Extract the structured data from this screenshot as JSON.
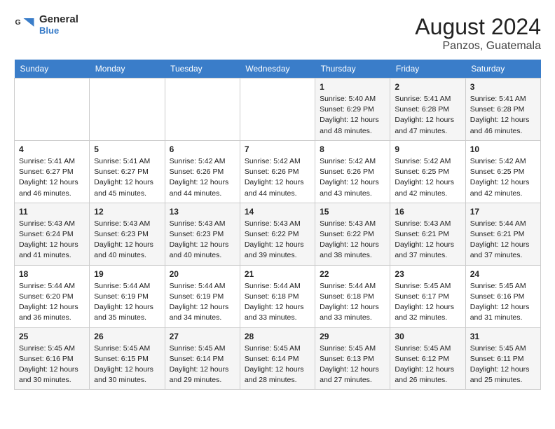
{
  "logo": {
    "name1": "General",
    "name2": "Blue",
    "icon_color": "#3a7dc9"
  },
  "title": "August 2024",
  "subtitle": "Panzos, Guatemala",
  "days_of_week": [
    "Sunday",
    "Monday",
    "Tuesday",
    "Wednesday",
    "Thursday",
    "Friday",
    "Saturday"
  ],
  "weeks": [
    [
      {
        "day": "",
        "info": ""
      },
      {
        "day": "",
        "info": ""
      },
      {
        "day": "",
        "info": ""
      },
      {
        "day": "",
        "info": ""
      },
      {
        "day": "1",
        "info": "Sunrise: 5:40 AM\nSunset: 6:29 PM\nDaylight: 12 hours\nand 48 minutes."
      },
      {
        "day": "2",
        "info": "Sunrise: 5:41 AM\nSunset: 6:28 PM\nDaylight: 12 hours\nand 47 minutes."
      },
      {
        "day": "3",
        "info": "Sunrise: 5:41 AM\nSunset: 6:28 PM\nDaylight: 12 hours\nand 46 minutes."
      }
    ],
    [
      {
        "day": "4",
        "info": "Sunrise: 5:41 AM\nSunset: 6:27 PM\nDaylight: 12 hours\nand 46 minutes."
      },
      {
        "day": "5",
        "info": "Sunrise: 5:41 AM\nSunset: 6:27 PM\nDaylight: 12 hours\nand 45 minutes."
      },
      {
        "day": "6",
        "info": "Sunrise: 5:42 AM\nSunset: 6:26 PM\nDaylight: 12 hours\nand 44 minutes."
      },
      {
        "day": "7",
        "info": "Sunrise: 5:42 AM\nSunset: 6:26 PM\nDaylight: 12 hours\nand 44 minutes."
      },
      {
        "day": "8",
        "info": "Sunrise: 5:42 AM\nSunset: 6:26 PM\nDaylight: 12 hours\nand 43 minutes."
      },
      {
        "day": "9",
        "info": "Sunrise: 5:42 AM\nSunset: 6:25 PM\nDaylight: 12 hours\nand 42 minutes."
      },
      {
        "day": "10",
        "info": "Sunrise: 5:42 AM\nSunset: 6:25 PM\nDaylight: 12 hours\nand 42 minutes."
      }
    ],
    [
      {
        "day": "11",
        "info": "Sunrise: 5:43 AM\nSunset: 6:24 PM\nDaylight: 12 hours\nand 41 minutes."
      },
      {
        "day": "12",
        "info": "Sunrise: 5:43 AM\nSunset: 6:23 PM\nDaylight: 12 hours\nand 40 minutes."
      },
      {
        "day": "13",
        "info": "Sunrise: 5:43 AM\nSunset: 6:23 PM\nDaylight: 12 hours\nand 40 minutes."
      },
      {
        "day": "14",
        "info": "Sunrise: 5:43 AM\nSunset: 6:22 PM\nDaylight: 12 hours\nand 39 minutes."
      },
      {
        "day": "15",
        "info": "Sunrise: 5:43 AM\nSunset: 6:22 PM\nDaylight: 12 hours\nand 38 minutes."
      },
      {
        "day": "16",
        "info": "Sunrise: 5:43 AM\nSunset: 6:21 PM\nDaylight: 12 hours\nand 37 minutes."
      },
      {
        "day": "17",
        "info": "Sunrise: 5:44 AM\nSunset: 6:21 PM\nDaylight: 12 hours\nand 37 minutes."
      }
    ],
    [
      {
        "day": "18",
        "info": "Sunrise: 5:44 AM\nSunset: 6:20 PM\nDaylight: 12 hours\nand 36 minutes."
      },
      {
        "day": "19",
        "info": "Sunrise: 5:44 AM\nSunset: 6:19 PM\nDaylight: 12 hours\nand 35 minutes."
      },
      {
        "day": "20",
        "info": "Sunrise: 5:44 AM\nSunset: 6:19 PM\nDaylight: 12 hours\nand 34 minutes."
      },
      {
        "day": "21",
        "info": "Sunrise: 5:44 AM\nSunset: 6:18 PM\nDaylight: 12 hours\nand 33 minutes."
      },
      {
        "day": "22",
        "info": "Sunrise: 5:44 AM\nSunset: 6:18 PM\nDaylight: 12 hours\nand 33 minutes."
      },
      {
        "day": "23",
        "info": "Sunrise: 5:45 AM\nSunset: 6:17 PM\nDaylight: 12 hours\nand 32 minutes."
      },
      {
        "day": "24",
        "info": "Sunrise: 5:45 AM\nSunset: 6:16 PM\nDaylight: 12 hours\nand 31 minutes."
      }
    ],
    [
      {
        "day": "25",
        "info": "Sunrise: 5:45 AM\nSunset: 6:16 PM\nDaylight: 12 hours\nand 30 minutes."
      },
      {
        "day": "26",
        "info": "Sunrise: 5:45 AM\nSunset: 6:15 PM\nDaylight: 12 hours\nand 30 minutes."
      },
      {
        "day": "27",
        "info": "Sunrise: 5:45 AM\nSunset: 6:14 PM\nDaylight: 12 hours\nand 29 minutes."
      },
      {
        "day": "28",
        "info": "Sunrise: 5:45 AM\nSunset: 6:14 PM\nDaylight: 12 hours\nand 28 minutes."
      },
      {
        "day": "29",
        "info": "Sunrise: 5:45 AM\nSunset: 6:13 PM\nDaylight: 12 hours\nand 27 minutes."
      },
      {
        "day": "30",
        "info": "Sunrise: 5:45 AM\nSunset: 6:12 PM\nDaylight: 12 hours\nand 26 minutes."
      },
      {
        "day": "31",
        "info": "Sunrise: 5:45 AM\nSunset: 6:11 PM\nDaylight: 12 hours\nand 25 minutes."
      }
    ]
  ]
}
